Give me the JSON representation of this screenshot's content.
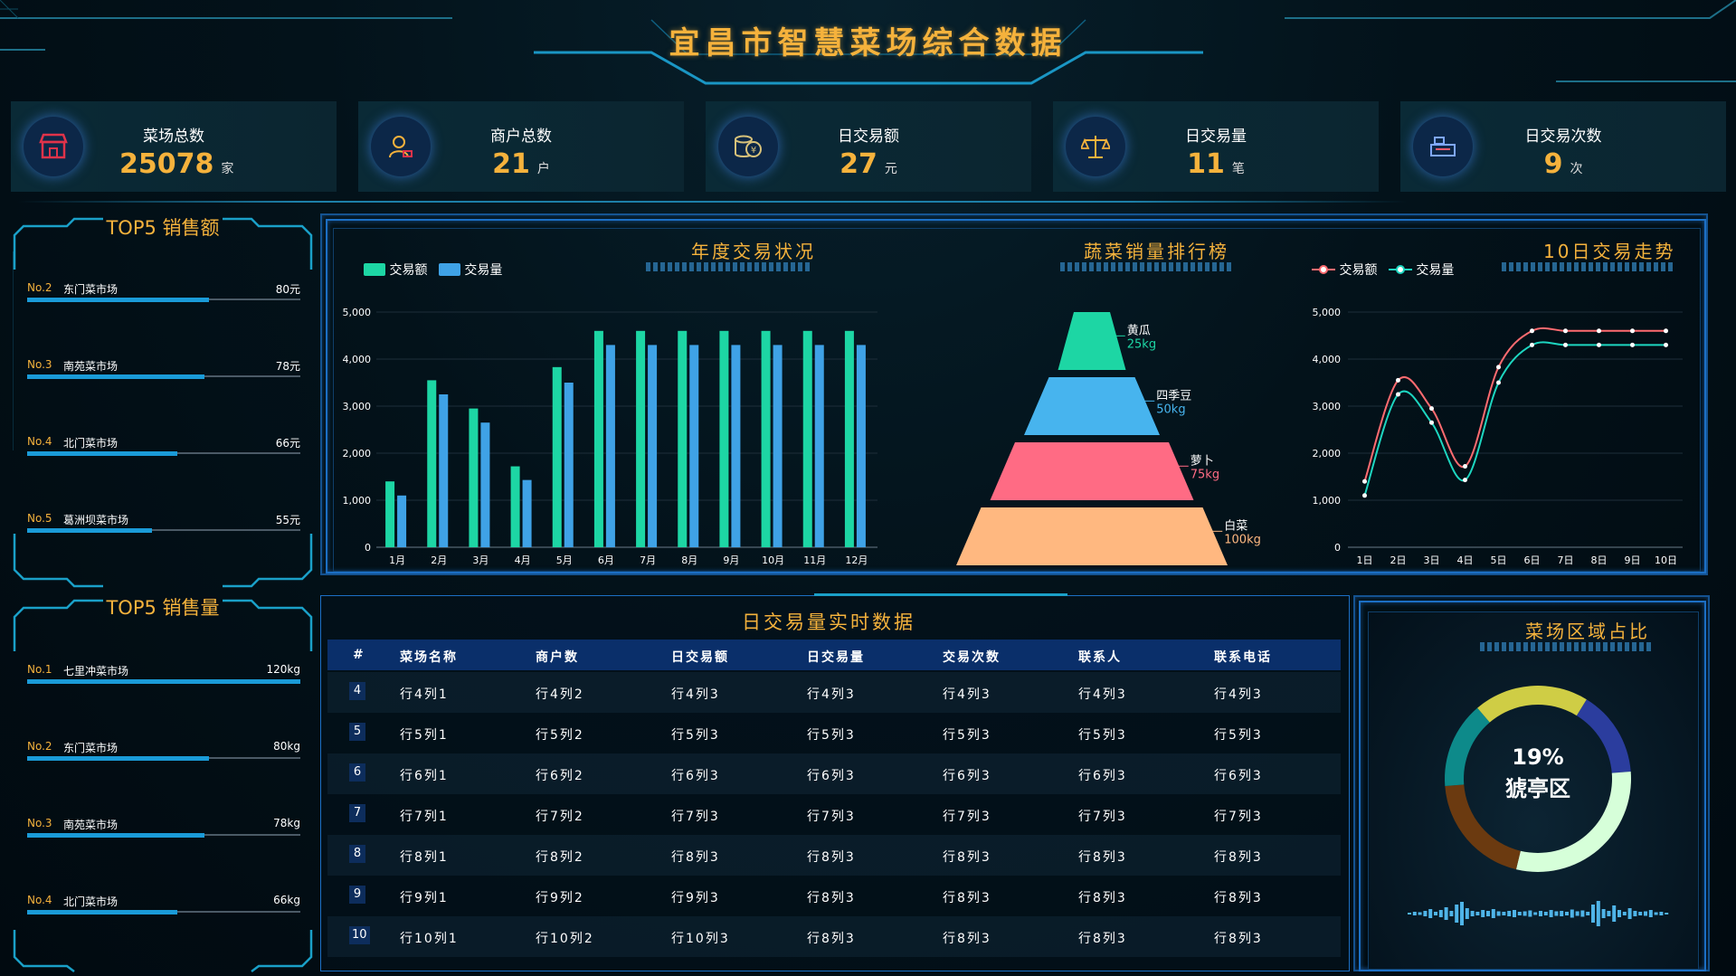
{
  "header": {
    "title": "宜昌市智慧菜场综合数据"
  },
  "stats": [
    {
      "label": "菜场总数",
      "value": "25078",
      "unit": "家",
      "icon": "store-icon"
    },
    {
      "label": "商户总数",
      "value": "21",
      "unit": "户",
      "icon": "user-icon"
    },
    {
      "label": "日交易额",
      "value": "27",
      "unit": "元",
      "icon": "coins-icon"
    },
    {
      "label": "日交易量",
      "value": "11",
      "unit": "笔",
      "icon": "scale-icon"
    },
    {
      "label": "日交易次数",
      "value": "9",
      "unit": "次",
      "icon": "register-icon"
    }
  ],
  "top5_sales": {
    "title": "TOP5 销售额",
    "items": [
      {
        "rank": "No.2",
        "name": "东门菜市场",
        "value": "80元",
        "amount": 80
      },
      {
        "rank": "No.3",
        "name": "南苑菜市场",
        "value": "78元",
        "amount": 78
      },
      {
        "rank": "No.4",
        "name": "北门菜市场",
        "value": "66元",
        "amount": 66
      },
      {
        "rank": "No.5",
        "name": "葛洲坝菜市场",
        "value": "55元",
        "amount": 55
      }
    ]
  },
  "top5_volume": {
    "title": "TOP5 销售量",
    "items": [
      {
        "rank": "No.1",
        "name": "七里冲菜市场",
        "value": "120kg",
        "amount": 120
      },
      {
        "rank": "No.2",
        "name": "东门菜市场",
        "value": "80kg",
        "amount": 80
      },
      {
        "rank": "No.3",
        "name": "南苑菜市场",
        "value": "78kg",
        "amount": 78
      },
      {
        "rank": "No.4",
        "name": "北门菜市场",
        "value": "66kg",
        "amount": 66
      }
    ]
  },
  "chart_data": [
    {
      "type": "bar",
      "title": "年度交易状况",
      "categories": [
        "1月",
        "2月",
        "3月",
        "4月",
        "5月",
        "6月",
        "7月",
        "8月",
        "9月",
        "10月",
        "11月",
        "12月"
      ],
      "series": [
        {
          "name": "交易额",
          "color": "#1dd6a4",
          "values": [
            1400,
            3550,
            2950,
            1720,
            3830,
            4600,
            4600,
            4600,
            4600,
            4600,
            4600,
            4600
          ]
        },
        {
          "name": "交易量",
          "color": "#3fa2e6",
          "values": [
            1100,
            3250,
            2650,
            1430,
            3500,
            4300,
            4300,
            4300,
            4300,
            4300,
            4300,
            4300
          ]
        }
      ],
      "yticks": [
        "0",
        "1,000",
        "2,000",
        "3,000",
        "4,000",
        "5,000"
      ],
      "ylim": [
        0,
        5000
      ]
    },
    {
      "type": "funnel",
      "title": "蔬菜销量排行榜",
      "items": [
        {
          "name": "黄瓜",
          "value": "25kg",
          "amount": 25,
          "color": "#1dd6a4"
        },
        {
          "name": "四季豆",
          "value": "50kg",
          "amount": 50,
          "color": "#47b4ee"
        },
        {
          "name": "萝卜",
          "value": "75kg",
          "amount": 75,
          "color": "#ff6b84"
        },
        {
          "name": "白菜",
          "value": "100kg",
          "amount": 100,
          "color": "#ffb880"
        }
      ]
    },
    {
      "type": "line",
      "title": "10日交易走势",
      "categories": [
        "1日",
        "2日",
        "3日",
        "4日",
        "5日",
        "6日",
        "7日",
        "8日",
        "9日",
        "10日"
      ],
      "series": [
        {
          "name": "交易额",
          "color": "#ff6b70",
          "values": [
            1400,
            3550,
            2950,
            1720,
            3830,
            4600,
            4600,
            4600,
            4600,
            4600
          ]
        },
        {
          "name": "交易量",
          "color": "#1dd6c0",
          "values": [
            1100,
            3250,
            2650,
            1430,
            3500,
            4300,
            4300,
            4300,
            4300,
            4300
          ]
        }
      ],
      "yticks": [
        "0",
        "1,000",
        "2,000",
        "3,000",
        "4,000",
        "5,000"
      ],
      "ylim": [
        0,
        5000
      ]
    },
    {
      "type": "pie",
      "title": "菜场区域占比",
      "center_value": "19%",
      "center_label": "猇亭区",
      "slices": [
        {
          "value": 15,
          "color": "#2b3d9e"
        },
        {
          "value": 30,
          "color": "#d6ffd9"
        },
        {
          "value": 20,
          "color": "#6b3a10"
        },
        {
          "value": 15,
          "color": "#0d8a8a"
        },
        {
          "value": 20,
          "color": "#cfcd45"
        }
      ]
    }
  ],
  "table": {
    "title": "日交易量实时数据",
    "columns": [
      "#",
      "菜场名称",
      "商户数",
      "日交易额",
      "日交易量",
      "交易次数",
      "联系人",
      "联系电话"
    ],
    "rows": [
      [
        "4",
        "行4列1",
        "行4列2",
        "行4列3",
        "行4列3",
        "行4列3",
        "行4列3",
        "行4列3"
      ],
      [
        "5",
        "行5列1",
        "行5列2",
        "行5列3",
        "行5列3",
        "行5列3",
        "行5列3",
        "行5列3"
      ],
      [
        "6",
        "行6列1",
        "行6列2",
        "行6列3",
        "行6列3",
        "行6列3",
        "行6列3",
        "行6列3"
      ],
      [
        "7",
        "行7列1",
        "行7列2",
        "行7列3",
        "行7列3",
        "行7列3",
        "行7列3",
        "行7列3"
      ],
      [
        "8",
        "行8列1",
        "行8列2",
        "行8列3",
        "行8列3",
        "行8列3",
        "行8列3",
        "行8列3"
      ],
      [
        "9",
        "行9列1",
        "行9列2",
        "行9列3",
        "行8列3",
        "行8列3",
        "行8列3",
        "行8列3"
      ],
      [
        "10",
        "行10列1",
        "行10列2",
        "行10列3",
        "行8列3",
        "行8列3",
        "行8列3",
        "行8列3"
      ]
    ]
  }
}
